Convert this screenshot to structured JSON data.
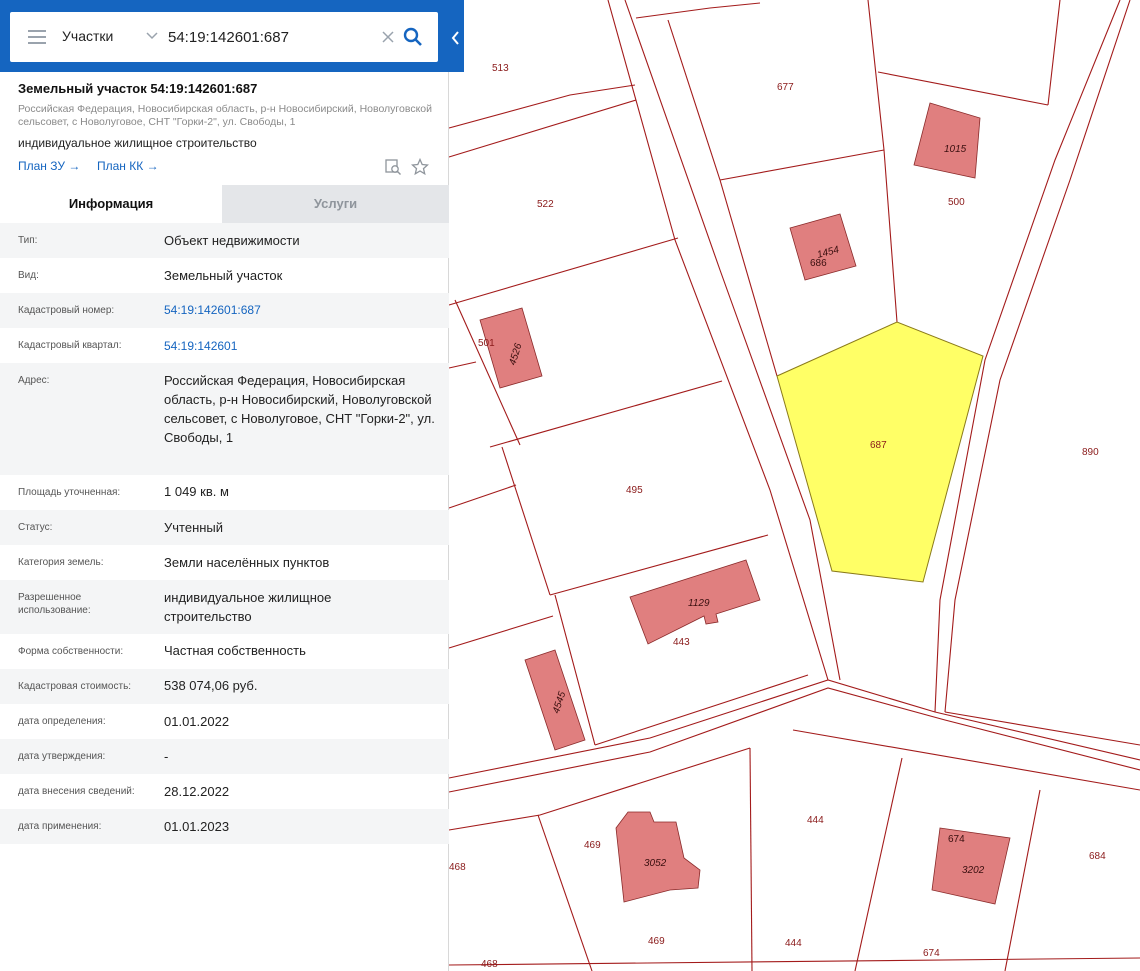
{
  "search": {
    "type_label": "Участки",
    "query": "54:19:142601:687"
  },
  "header": {
    "title": "Земельный участок 54:19:142601:687",
    "address_short": "Российская Федерация, Новосибирская область, р-н Новосибирский, Новолуговской сельсовет, с Новолуговое, СНТ \"Горки-2\", ул. Свободы, 1",
    "use": "индивидуальное жилищное строительство",
    "links": {
      "plan_zu": "План ЗУ →",
      "plan_kk": "План КК →"
    }
  },
  "tabs": {
    "info": "Информация",
    "services": "Услуги"
  },
  "rows": [
    {
      "label": "Тип:",
      "value": "Объект недвижимости"
    },
    {
      "label": "Вид:",
      "value": "Земельный участок"
    },
    {
      "label": "Кадастровый номер:",
      "value": "54:19:142601:687"
    },
    {
      "label": "Кадастровый квартал:",
      "value": "54:19:142601"
    },
    {
      "label": "Адрес:",
      "value": "Российская Федерация, Новосибирская область, р-н Новосибирский, Новолуговской сельсовет, с Новолуговое, СНТ \"Горки-2\", ул. Свободы, 1"
    },
    {
      "label": "Площадь уточненная:",
      "value": "1 049 кв. м"
    },
    {
      "label": "Статус:",
      "value": "Учтенный"
    },
    {
      "label": "Категория земель:",
      "value": "Земли населённых пунктов"
    },
    {
      "label": "Разрешенное использование:",
      "value": "индивидуальное жилищное строительство"
    },
    {
      "label": "Форма собственности:",
      "value": "Частная собственность"
    },
    {
      "label": "Кадастровая стоимость:",
      "value": "538 074,06 руб."
    },
    {
      "label": "дата определения:",
      "value": "01.01.2022"
    },
    {
      "label": "дата утверждения:",
      "value": "-"
    },
    {
      "label": "дата внесения сведений:",
      "value": "28.12.2022"
    },
    {
      "label": "дата применения:",
      "value": "01.01.2023"
    }
  ],
  "map": {
    "parcel_labels": [
      "513",
      "677",
      "522",
      "500",
      "501",
      "495",
      "687",
      "890",
      "443",
      "444",
      "469",
      "468",
      "674",
      "684"
    ],
    "building_labels": [
      "1015",
      "1454",
      "686",
      "4526",
      "1129",
      "4545",
      "3052",
      "3202",
      "674"
    ],
    "colors": {
      "parcel_border": "#a31b1b",
      "building_fill": "#e07f7f",
      "selected_fill": "#ffff66",
      "panel_header": "#1565c0",
      "link": "#1565c0"
    }
  }
}
